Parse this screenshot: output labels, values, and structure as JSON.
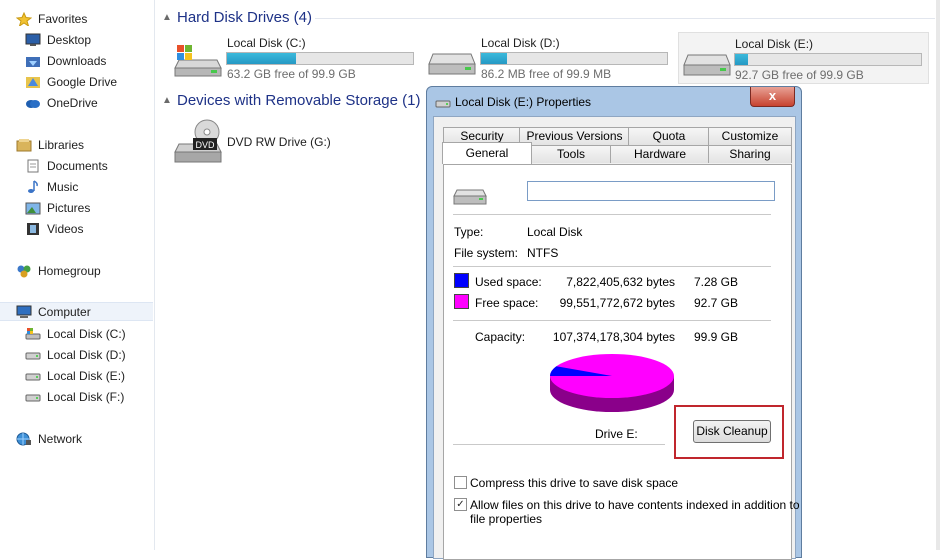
{
  "sidebar": {
    "favorites": {
      "label": "Favorites",
      "items": [
        {
          "label": "Desktop"
        },
        {
          "label": "Downloads"
        },
        {
          "label": "Google Drive"
        },
        {
          "label": "OneDrive"
        }
      ]
    },
    "libraries": {
      "label": "Libraries",
      "items": [
        {
          "label": "Documents"
        },
        {
          "label": "Music"
        },
        {
          "label": "Pictures"
        },
        {
          "label": "Videos"
        }
      ]
    },
    "homegroup": {
      "label": "Homegroup"
    },
    "computer": {
      "label": "Computer",
      "items": [
        {
          "label": "Local Disk (C:)"
        },
        {
          "label": "Local Disk (D:)"
        },
        {
          "label": "Local Disk (E:)"
        },
        {
          "label": "Local Disk (F:)"
        }
      ]
    },
    "network": {
      "label": "Network"
    }
  },
  "content": {
    "hdd_group": "Hard Disk Drives (4)",
    "drives": [
      {
        "name": "Local Disk (C:)",
        "free": "63.2 GB free of 99.9 GB",
        "used_fraction": 0.37
      },
      {
        "name": "Local Disk (D:)",
        "free": "86.2 MB free of 99.9 MB",
        "used_fraction": 0.14
      },
      {
        "name": "Local Disk (E:)",
        "free": "92.7 GB free of 99.9 GB",
        "used_fraction": 0.07
      }
    ],
    "removable_group": "Devices with Removable Storage (1)",
    "dvd": {
      "name": "DVD RW Drive (G:)",
      "badge": "DVD"
    }
  },
  "dialog": {
    "title": "Local Disk (E:) Properties",
    "close": "x",
    "tabs_back": [
      "Security",
      "Previous Versions",
      "Quota",
      "Customize"
    ],
    "tabs_front": [
      "General",
      "Tools",
      "Hardware",
      "Sharing"
    ],
    "active_tab": "General",
    "name_value": "",
    "type_label": "Type:",
    "type_value": "Local Disk",
    "fs_label": "File system:",
    "fs_value": "NTFS",
    "used_label": "Used space:",
    "used_bytes": "7,822,405,632 bytes",
    "used_gb": "7.28 GB",
    "free_label": "Free space:",
    "free_bytes": "99,551,772,672 bytes",
    "free_gb": "92.7 GB",
    "capacity_label": "Capacity:",
    "capacity_bytes": "107,374,178,304 bytes",
    "capacity_gb": "99.9 GB",
    "used_fraction": 0.0728,
    "used_color": "#0000ff",
    "free_color": "#ff00ff",
    "drive_label": "Drive E:",
    "cleanup_button": "Disk Cleanup",
    "compress_label": "Compress this drive to save disk space",
    "compress_checked": false,
    "index_label_1": "Allow files on this drive to have contents indexed in addition to",
    "index_label_2": "file properties",
    "index_checked": true
  }
}
